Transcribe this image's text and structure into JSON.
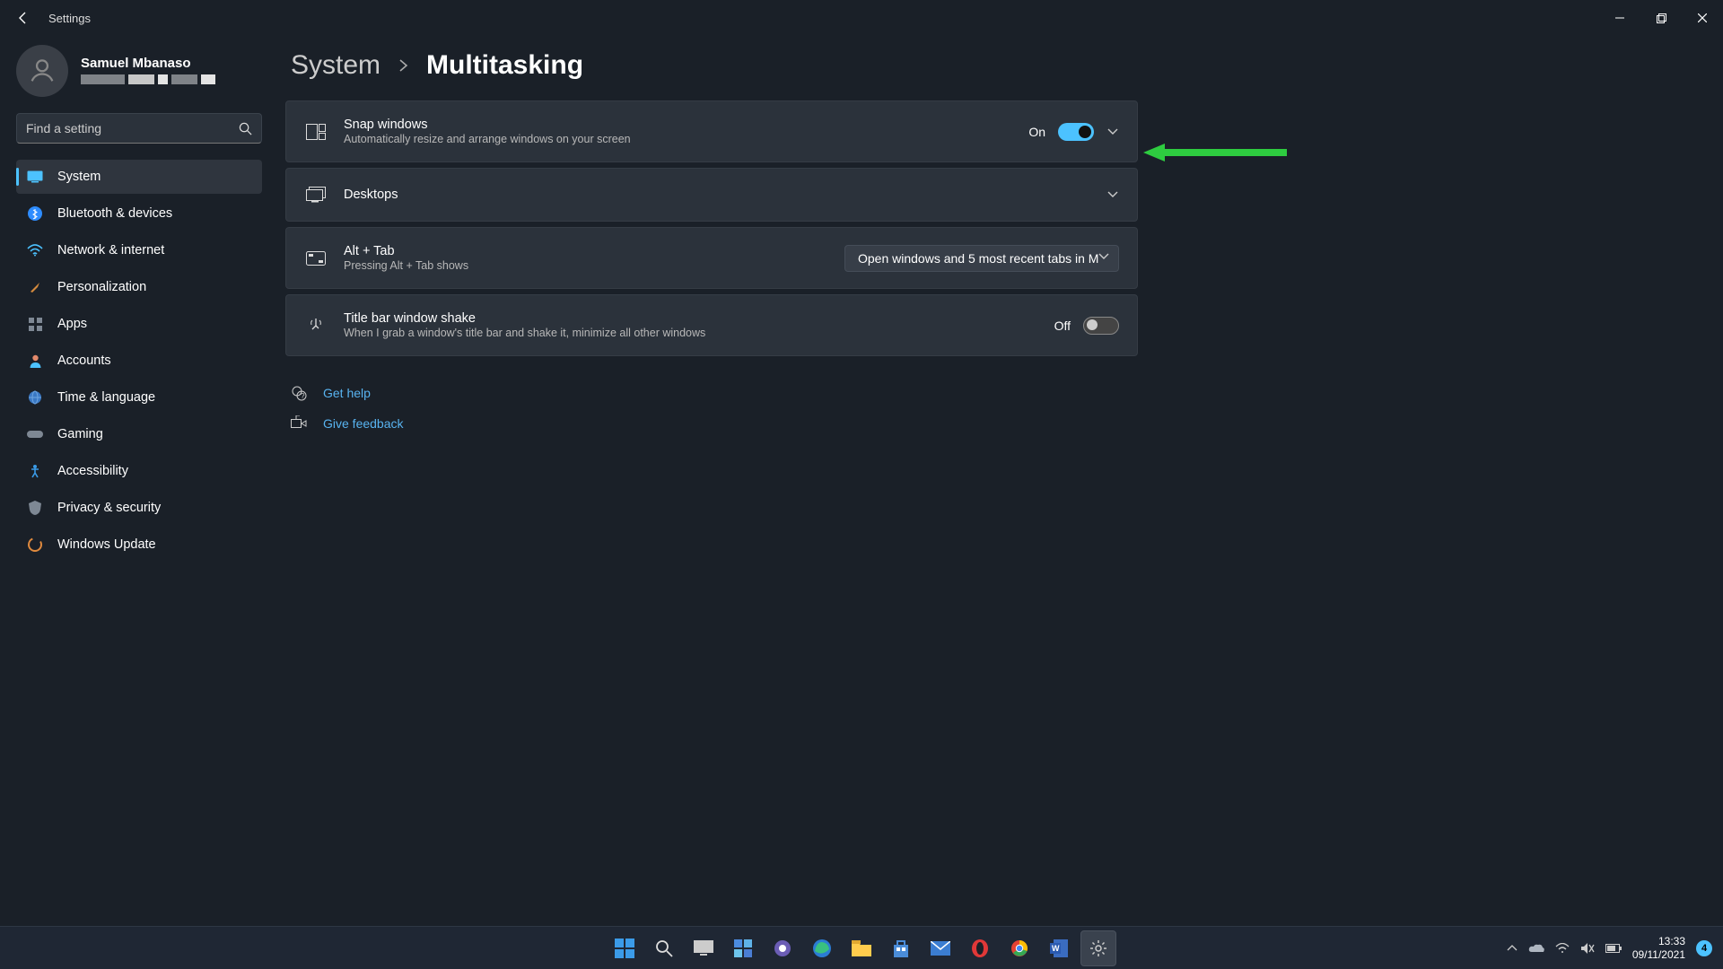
{
  "window": {
    "title": "Settings"
  },
  "user": {
    "name": "Samuel Mbanaso"
  },
  "search": {
    "placeholder": "Find a setting"
  },
  "sidebar": {
    "items": [
      {
        "label": "System",
        "active": true,
        "icon": "display"
      },
      {
        "label": "Bluetooth & devices",
        "icon": "bluetooth"
      },
      {
        "label": "Network & internet",
        "icon": "wifi"
      },
      {
        "label": "Personalization",
        "icon": "brush"
      },
      {
        "label": "Apps",
        "icon": "grid"
      },
      {
        "label": "Accounts",
        "icon": "person"
      },
      {
        "label": "Time & language",
        "icon": "globe"
      },
      {
        "label": "Gaming",
        "icon": "gamepad"
      },
      {
        "label": "Accessibility",
        "icon": "accessibility"
      },
      {
        "label": "Privacy & security",
        "icon": "shield"
      },
      {
        "label": "Windows Update",
        "icon": "update"
      }
    ]
  },
  "breadcrumb": {
    "parent": "System",
    "current": "Multitasking"
  },
  "settings": {
    "snap": {
      "title": "Snap windows",
      "subtitle": "Automatically resize and arrange windows on your screen",
      "state_label": "On",
      "state": true
    },
    "desktops": {
      "title": "Desktops"
    },
    "alttab": {
      "title": "Alt + Tab",
      "subtitle": "Pressing Alt + Tab shows",
      "selected": "Open windows and 5 most recent tabs in M"
    },
    "shake": {
      "title": "Title bar window shake",
      "subtitle": "When I grab a window's title bar and shake it, minimize all other windows",
      "state_label": "Off",
      "state": false
    }
  },
  "help": {
    "get_help": "Get help",
    "feedback": "Give feedback"
  },
  "taskbar": {
    "time": "13:33",
    "date": "09/11/2021",
    "notif_count": "4"
  }
}
